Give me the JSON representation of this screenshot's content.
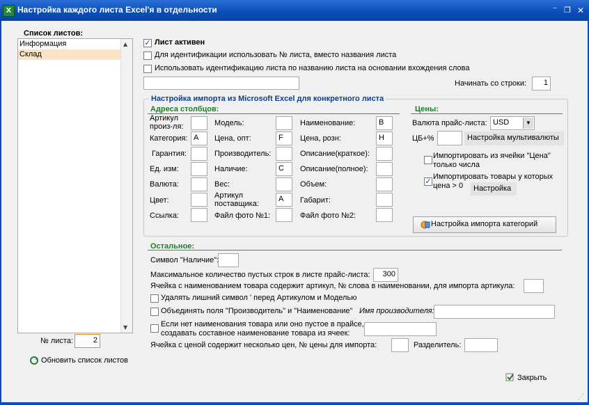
{
  "window": {
    "title": "Настройка каждого листа Excel'я в отдельности",
    "controls": [
      "⁻",
      "❐",
      "✕"
    ]
  },
  "left": {
    "list_title": "Список листов:",
    "sheets": [
      "Информация",
      "Склад"
    ],
    "selected_index": 1,
    "sheet_no_label": "№ листа:",
    "sheet_no_value": "2",
    "refresh_label": "Обновить список листов"
  },
  "top": {
    "sheet_active": "Лист активен",
    "use_number": "Для идентификации использовать № листа, вместо названия листа",
    "use_word": "Использовать идентификацию листа по названию листа на основании вхождения слова",
    "word_value": "",
    "start_row_label": "Начинать со строки:",
    "start_row_value": "1"
  },
  "import": {
    "group_title": "Настройка импорта из Microsoft Excel для конкретного листа",
    "columns_title": "Адреса столбцов:",
    "col1": [
      {
        "label": "Артикул\nпроиз-ля:",
        "value": ""
      },
      {
        "label": "Категория:",
        "value": "A"
      },
      {
        "label": "Гарантия:",
        "value": ""
      },
      {
        "label": "Ед. изм:",
        "value": ""
      },
      {
        "label": "Валюта:",
        "value": ""
      },
      {
        "label": "Цвет:",
        "value": ""
      },
      {
        "label": "Ссылка:",
        "value": ""
      }
    ],
    "col2": [
      {
        "label": "Модель:",
        "value": ""
      },
      {
        "label": "Цена, опт:",
        "value": "F"
      },
      {
        "label": "Производитель:",
        "value": ""
      },
      {
        "label": "Наличие:",
        "value": "C"
      },
      {
        "label": "Вес:",
        "value": ""
      },
      {
        "label": "Артикул\nпоставщика:",
        "value": "A"
      },
      {
        "label": "Файл фото №1:",
        "value": ""
      }
    ],
    "col3": [
      {
        "label": "Наименование:",
        "value": "B"
      },
      {
        "label": "Цена, розн:",
        "value": "H"
      },
      {
        "label": "Описание(краткое):",
        "value": ""
      },
      {
        "label": "Описание(полное):",
        "value": ""
      },
      {
        "label": "Объем:",
        "value": ""
      },
      {
        "label": "Габарит:",
        "value": ""
      },
      {
        "label": "Файл фото №2:",
        "value": ""
      }
    ],
    "prices_title": "Цены:",
    "currency_label": "Валюта прайс-листа:",
    "currency_value": "USD",
    "cb_label": "ЦБ+%",
    "cb_value": "",
    "multicurrency_label": "Настройка мультивалюты",
    "import_from_cell": "Импортировать из ячейки \"Цена\"\nтолько числа",
    "import_price_gt0": "Импортировать товары у которых\nцена > 0",
    "settings_label": "Настройка",
    "category_import_label": "Настройка импорта категорий"
  },
  "other": {
    "title": "Остальное:",
    "availability_symbol_label": "Символ \"Наличие\":",
    "availability_symbol_value": "",
    "max_empty_label": "Максимальное количество пустых строк в листе прайс-листа:",
    "max_empty_value": "300",
    "article_in_name_label": "Ячейка с наименованием товара содержит артикул, № слова в наименовании, для импорта артикула:",
    "article_in_name_value": "",
    "remove_symbol": "Удалять лишний символ ' перед Артикулом и Моделью",
    "merge_fields": "Объединять поля \"Производитель\" и \"Наименование\"",
    "manufacturer_name_label": "Имя производителя:",
    "manufacturer_name_value": "",
    "compose_name": "Если нет наименования товара или оно пустое в прайсе,\nсоздавать составное наименование товара из ячеек:",
    "compose_value": "",
    "multi_price_label": "Ячейка с ценой содержит несколько цен, № цены для импорта:",
    "multi_price_value": "",
    "separator_label": "Разделитель:",
    "separator_value": ""
  },
  "footer": {
    "close_label": "Закрыть"
  },
  "colors": {
    "title_bar": "#0a4fb8",
    "section_blue": "#0b3d91",
    "section_green": "#1a7f2b",
    "selected_row": "#fbe3c8"
  }
}
